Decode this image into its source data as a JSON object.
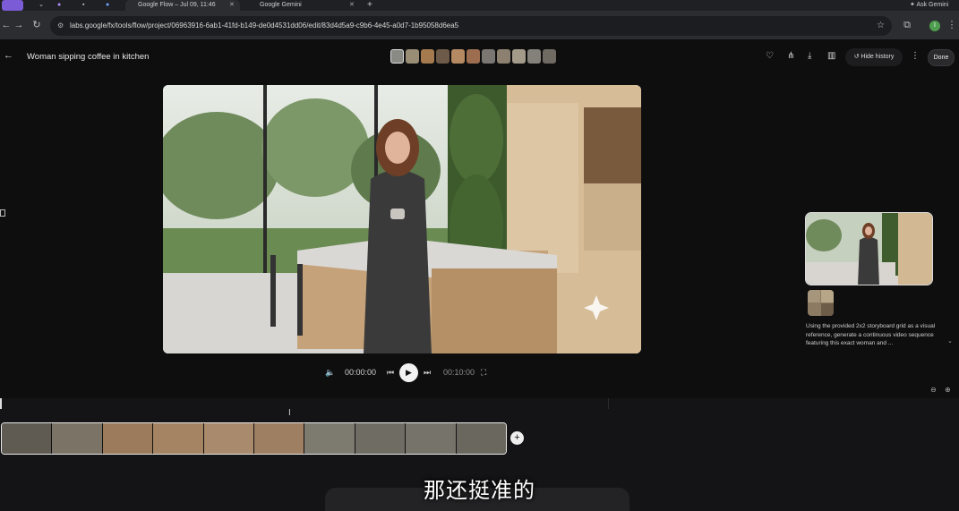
{
  "browser": {
    "tabs": [
      {
        "label": "Google Flow – Jul 09, 11:46"
      },
      {
        "label": "Google Gemini"
      }
    ],
    "ask_gemini": "Ask Gemini",
    "url": "labs.google/fx/tools/flow/project/06963916-6ab1-41fd-b149-de0d4531dd06/edit/83d4d5a9-c9b6-4e45-a0d7-1b95058d6ea5",
    "profile_initial": "I"
  },
  "header": {
    "project_title": "Woman sipping coffee in kitchen",
    "hide_history_label": "Hide history",
    "done_label": "Done"
  },
  "player": {
    "current_time": "00:00:00",
    "total_time": "00:10:00"
  },
  "side_panel": {
    "prompt_text": "Using the provided 2x2 storyboard grid as a visual reference, generate a continuous video sequence featuring this exact woman and ..."
  },
  "subtitle": "那还挺准的",
  "colors": {
    "background": "#0e0e0f",
    "accent": "#f2f2f2",
    "clip_border": "#eaeaea"
  },
  "icons": [
    "back-arrow-icon",
    "heart-icon",
    "share-icon",
    "download-icon",
    "trash-icon",
    "history-icon",
    "more-vert-icon",
    "volume-icon",
    "skip-back-icon",
    "play-icon",
    "skip-forward-icon",
    "fullscreen-icon",
    "add-icon",
    "zoom-out-icon",
    "zoom-in-icon"
  ]
}
